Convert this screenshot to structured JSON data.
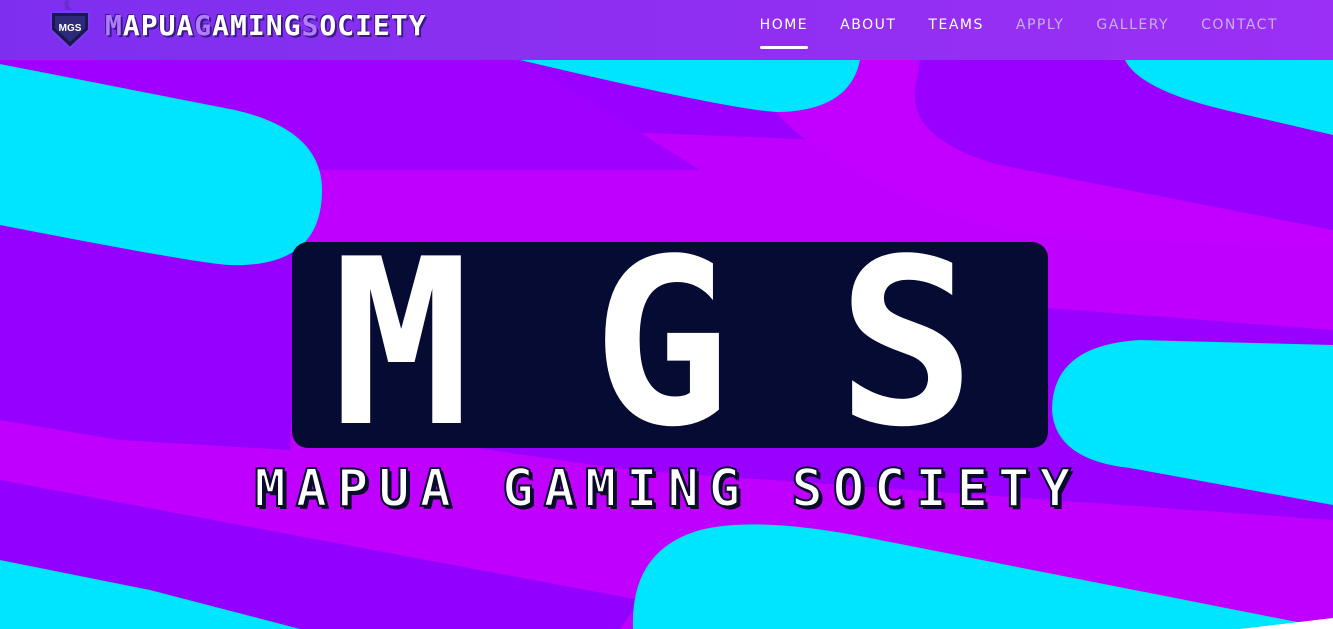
{
  "brand": {
    "name_parts": [
      {
        "cap": "M",
        "rest": "APUA"
      },
      {
        "cap": "G",
        "rest": "AMING"
      },
      {
        "cap": "S",
        "rest": "OCIETY"
      }
    ],
    "logo_text": "MGS"
  },
  "nav": {
    "items": [
      {
        "label": "HOME",
        "active": true
      },
      {
        "label": "ABOUT"
      },
      {
        "label": "TEAMS"
      },
      {
        "label": "APPLY"
      },
      {
        "label": "GALLERY"
      },
      {
        "label": "CONTACT"
      }
    ]
  },
  "hero": {
    "letters": [
      "M",
      "G",
      "S"
    ],
    "tagline": "MAPUA GAMING SOCIETY"
  },
  "colors": {
    "purple": "#9a00ff",
    "magenta": "#c000ff",
    "cyan": "#00e5ff",
    "navy": "#050b33"
  }
}
